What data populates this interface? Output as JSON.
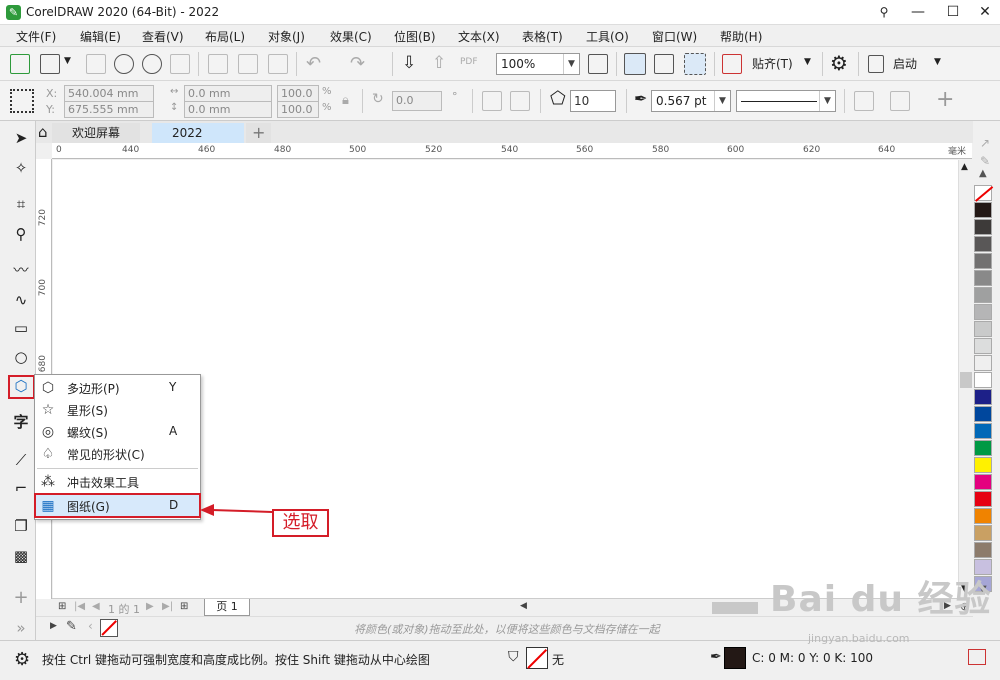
{
  "window": {
    "title": "CorelDRAW 2020 (64-Bit) - 2022",
    "app_icon_glyph": "✎",
    "min": "—",
    "max": "☐",
    "close": "✕"
  },
  "menu": [
    "文件(F)",
    "编辑(E)",
    "查看(V)",
    "布局(L)",
    "对象(J)",
    "效果(C)",
    "位图(B)",
    "文本(X)",
    "表格(T)",
    "工具(O)",
    "窗口(W)",
    "帮助(H)"
  ],
  "toolbar": {
    "zoom_value": "100%",
    "snap_label": "贴齐(T)",
    "launch_label": "启动",
    "pdf_label": "PDF"
  },
  "propbar": {
    "x_label": "X:",
    "y_label": "Y:",
    "x_value": "540.004 mm",
    "y_value": "675.555 mm",
    "w_value": "0.0 mm",
    "h_value": "0.0 mm",
    "scale_x": "100.0",
    "scale_y": "100.0",
    "pct": "%",
    "rotation": "0.0",
    "degree": "°",
    "sides": "10",
    "outline_width": "0.567 pt"
  },
  "doc_tabs": {
    "welcome": "欢迎屏幕",
    "doc": "2022",
    "add": "+"
  },
  "ruler": {
    "h_ticks": [
      "0",
      "440",
      "460",
      "480",
      "500",
      "520",
      "540",
      "560",
      "580",
      "600",
      "620",
      "640"
    ],
    "v_ticks": [
      "720",
      "700",
      "680"
    ],
    "unit": "毫米"
  },
  "flyout": {
    "items": [
      {
        "label": "多边形(P)",
        "key": "Y",
        "icon": "⬡"
      },
      {
        "label": "星形(S)",
        "key": "",
        "icon": "☆"
      },
      {
        "label": "螺纹(S)",
        "key": "A",
        "icon": "◎"
      },
      {
        "label": "常见的形状(C)",
        "key": "",
        "icon": "♤"
      },
      {
        "label": "冲击效果工具",
        "key": "",
        "icon": "⁂"
      },
      {
        "label": "图纸(G)",
        "key": "D",
        "icon": "▦"
      }
    ]
  },
  "annotation": {
    "callout": "选取",
    "color": "#d41d28"
  },
  "pagebar": {
    "page_info": "1 的 1",
    "page_tab": "页 1"
  },
  "colorbar_hint": "将颜色(或对象)拖动至此处，以便将这些颜色与文档存储在一起",
  "status": {
    "hint": "按住 Ctrl 键拖动可强制宽度和高度成比例。按住 Shift 键拖动从中心绘图",
    "fill_label": "无",
    "cmyk": "C: 0 M: 0 Y: 0 K: 100"
  },
  "palette_colors": [
    "#231815",
    "#3d3a39",
    "#595757",
    "#727171",
    "#898989",
    "#9fa0a0",
    "#b5b5b6",
    "#c9caca",
    "#dcdddd",
    "#efefef",
    "#ffffff",
    "#1d2088",
    "#00479d",
    "#0068b7",
    "#009944",
    "#fff100",
    "#e4007f",
    "#e60012",
    "#f08300",
    "#c9a063",
    "#8c7b6b",
    "#c8c0e0",
    "#a6a6d6"
  ],
  "watermark": {
    "main": "Bai du 经验",
    "sub": "jingyan.baidu.com"
  }
}
